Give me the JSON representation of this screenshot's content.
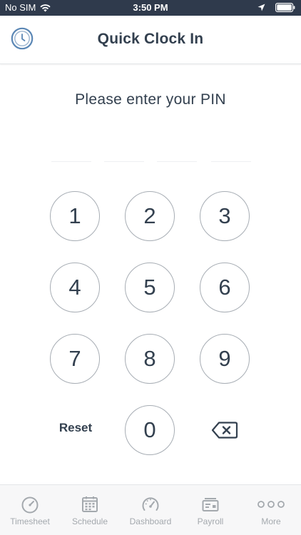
{
  "status_bar": {
    "carrier": "No SIM",
    "time": "3:50 PM"
  },
  "header": {
    "title": "Quick Clock In",
    "clock_icon": "clock-icon"
  },
  "prompt": "Please enter your PIN",
  "pin": {
    "length": 4,
    "entered": 0
  },
  "keypad": {
    "keys": [
      "1",
      "2",
      "3",
      "4",
      "5",
      "6",
      "7",
      "8",
      "9",
      "0"
    ],
    "reset_label": "Reset",
    "backspace_icon": "backspace-icon"
  },
  "tab_bar": {
    "tabs": [
      {
        "label": "Timesheet",
        "icon": "stopwatch-icon"
      },
      {
        "label": "Schedule",
        "icon": "calendar-icon"
      },
      {
        "label": "Dashboard",
        "icon": "speedometer-icon"
      },
      {
        "label": "Payroll",
        "icon": "payroll-card-icon"
      },
      {
        "label": "More",
        "icon": "more-dots-icon"
      }
    ]
  },
  "colors": {
    "status_bar_bg": "#2f3a4c",
    "text_primary": "#33404f",
    "key_border": "#a7adb4",
    "tab_inactive": "#a4a9ae",
    "clock_accent": "#5b87b5"
  }
}
